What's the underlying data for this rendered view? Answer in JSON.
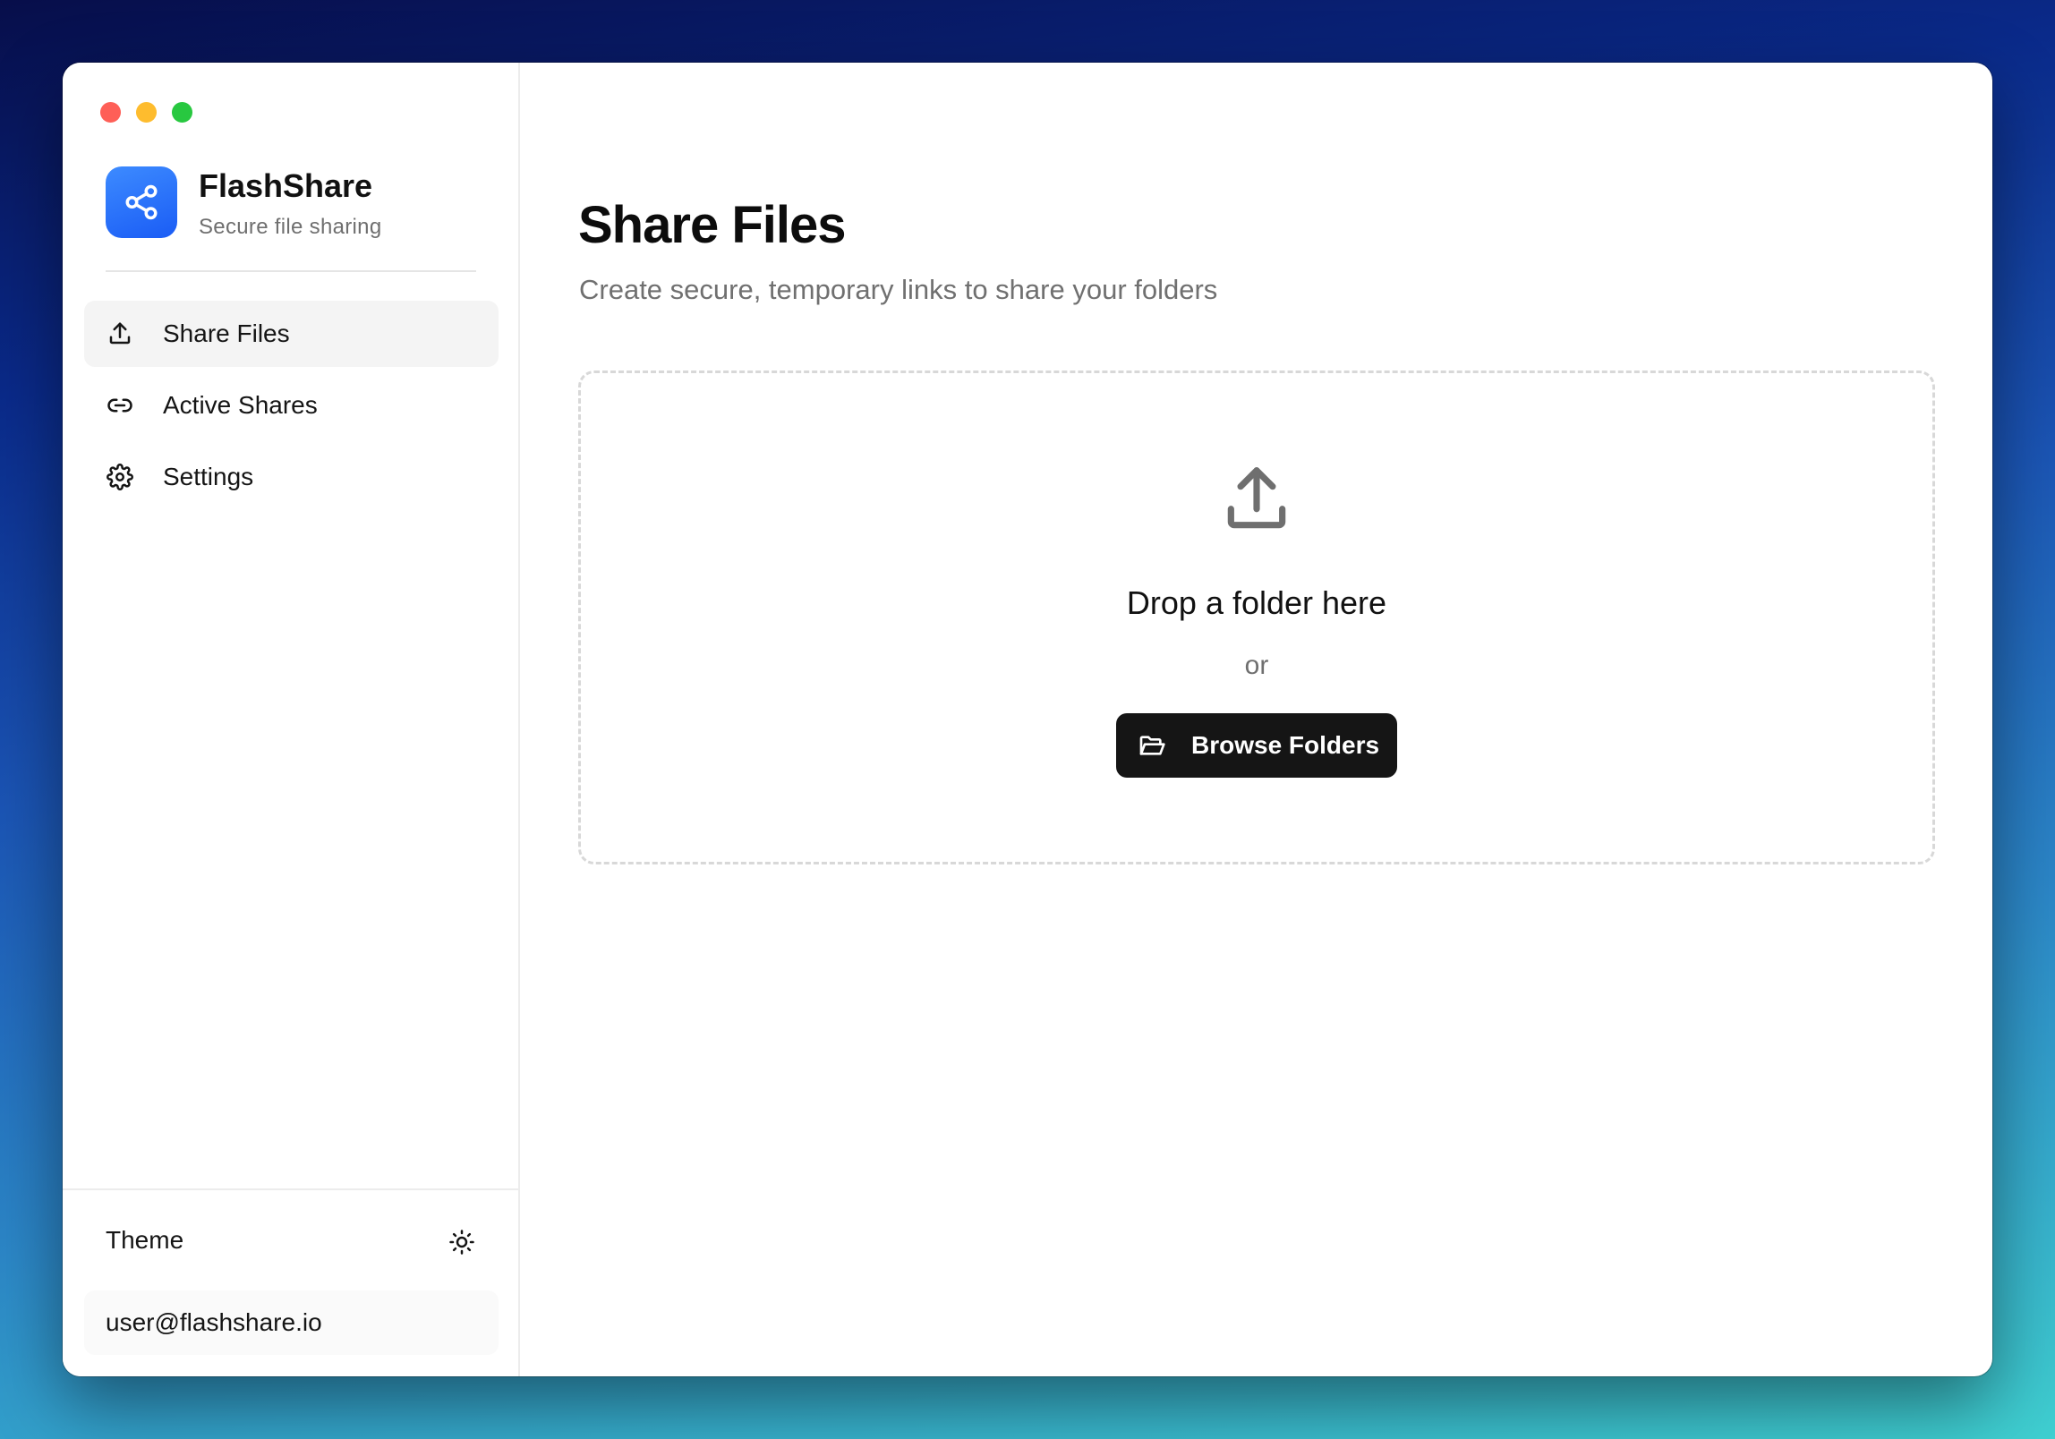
{
  "app": {
    "name": "FlashShare",
    "tagline": "Secure file sharing",
    "brand_color": "#2b6ff8"
  },
  "window_controls": {
    "close_color": "#fe5f57",
    "minimize_color": "#febc2e",
    "zoom_color": "#28c840"
  },
  "sidebar": {
    "items": [
      {
        "label": "Share Files",
        "icon": "upload-icon",
        "active": true
      },
      {
        "label": "Active Shares",
        "icon": "link-icon",
        "active": false
      },
      {
        "label": "Settings",
        "icon": "gear-icon",
        "active": false
      }
    ],
    "footer": {
      "theme_label": "Theme",
      "theme_icon": "sun-icon",
      "user_email": "user@flashshare.io"
    }
  },
  "main": {
    "title": "Share Files",
    "subtitle": "Create secure, temporary links to share your folders",
    "dropzone": {
      "icon": "upload-icon",
      "title": "Drop a folder here",
      "or_text": "or",
      "browse_label": "Browse Folders",
      "browse_icon": "folder-open-icon"
    }
  }
}
